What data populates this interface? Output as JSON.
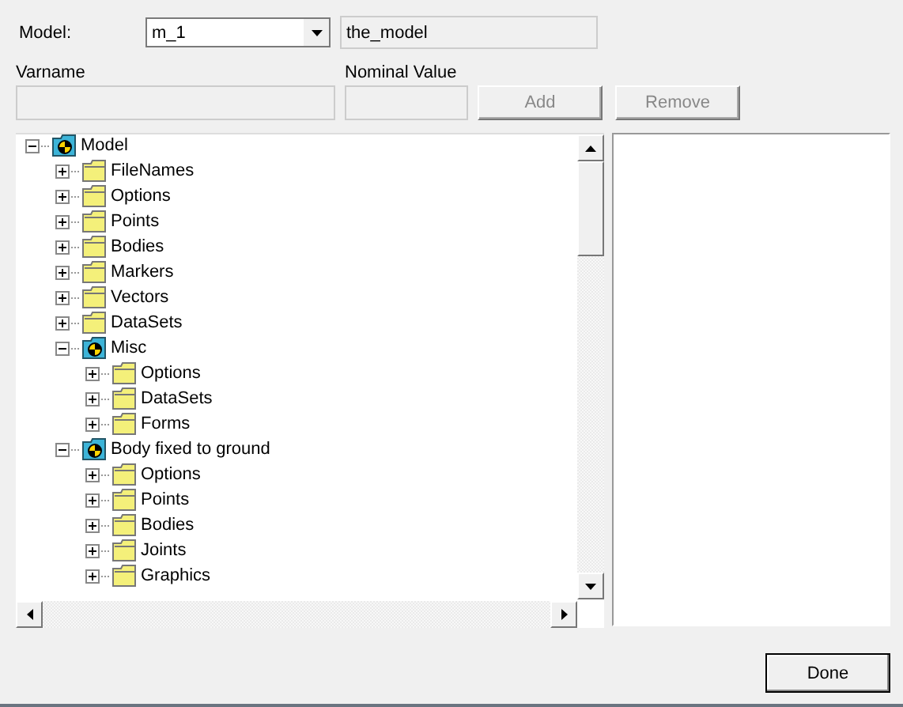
{
  "model_row": {
    "label": "Model:",
    "combo_value": "m_1",
    "name_value": "the_model"
  },
  "varname": {
    "label": "Varname"
  },
  "nominal": {
    "label": "Nominal Value"
  },
  "buttons": {
    "add": {
      "label": "Add",
      "disabled": true
    },
    "remove": {
      "label": "Remove",
      "disabled": true
    },
    "done": {
      "label": "Done",
      "disabled": false
    }
  },
  "tree": [
    {
      "label": "Model",
      "kind": "model",
      "expanded": true,
      "children": [
        {
          "label": "FileNames",
          "kind": "folder",
          "expanded": false
        },
        {
          "label": "Options",
          "kind": "folder",
          "expanded": false
        },
        {
          "label": "Points",
          "kind": "folder",
          "expanded": false
        },
        {
          "label": "Bodies",
          "kind": "folder",
          "expanded": false
        },
        {
          "label": "Markers",
          "kind": "folder",
          "expanded": false
        },
        {
          "label": "Vectors",
          "kind": "folder",
          "expanded": false
        },
        {
          "label": "DataSets",
          "kind": "folder",
          "expanded": false
        },
        {
          "label": "Misc",
          "kind": "model",
          "expanded": true,
          "children": [
            {
              "label": "Options",
              "kind": "folder",
              "expanded": false
            },
            {
              "label": "DataSets",
              "kind": "folder",
              "expanded": false
            },
            {
              "label": "Forms",
              "kind": "folder",
              "expanded": false
            }
          ]
        },
        {
          "label": "Body fixed to ground",
          "kind": "model",
          "expanded": true,
          "children": [
            {
              "label": "Options",
              "kind": "folder",
              "expanded": false
            },
            {
              "label": "Points",
              "kind": "folder",
              "expanded": false
            },
            {
              "label": "Bodies",
              "kind": "folder",
              "expanded": false
            },
            {
              "label": "Joints",
              "kind": "folder",
              "expanded": false
            },
            {
              "label": "Graphics",
              "kind": "folder",
              "expanded": false
            }
          ]
        }
      ]
    }
  ]
}
